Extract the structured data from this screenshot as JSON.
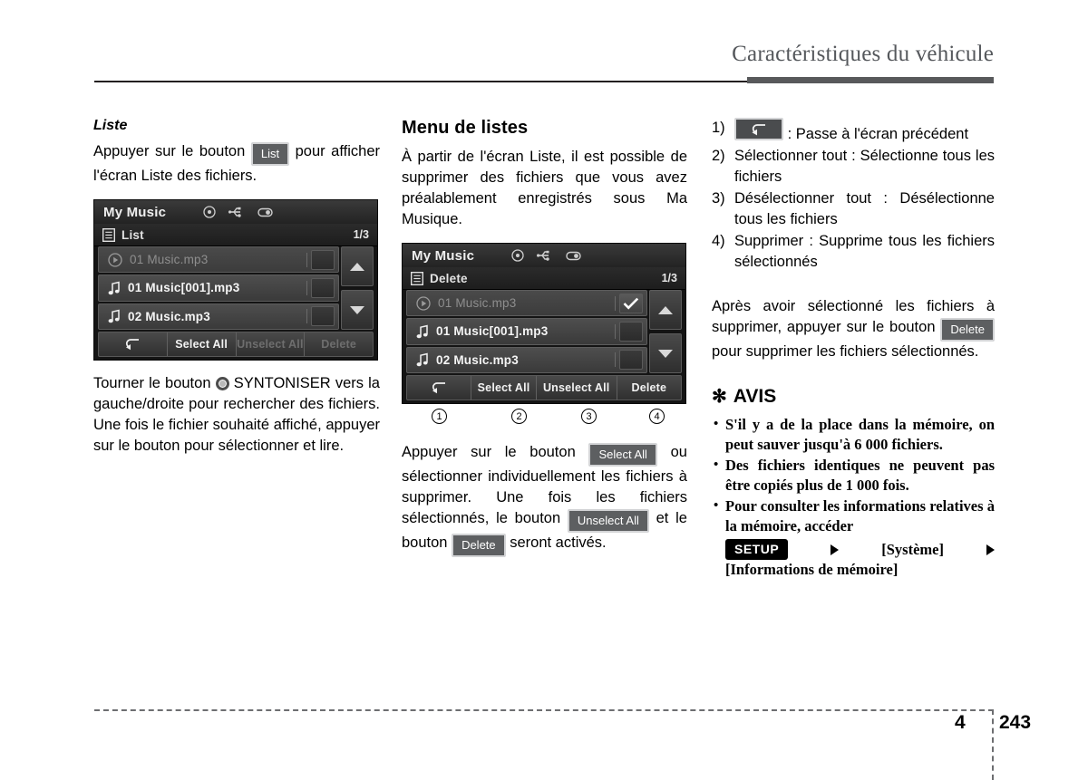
{
  "header": {
    "title": "Caractéristiques du véhicule"
  },
  "footer": {
    "chapter": "4",
    "page": "243"
  },
  "left_column": {
    "section_title": "Liste",
    "paragraph_1_before": "Appuyer sur le bouton",
    "list_button_label": "List",
    "paragraph_1_after": "pour afficher l'écran Liste des fichiers.",
    "paragraph_2_before": "Tourner le bouton",
    "paragraph_2_after": "SYNTONISER vers la gauche/droite pour rechercher des fichiers. Une fois le fichier souhaité affiché, appuyer sur le bouton pour sélectionner et lire."
  },
  "screenshot_list": {
    "title": "My Music",
    "submenu_label": "List",
    "page_indicator": "1/3",
    "rows": [
      {
        "label": "01 Music.mp3",
        "icon": "play-circle-icon",
        "playing": true,
        "checked": false
      },
      {
        "label": "01 Music[001].mp3",
        "icon": "music-note-icon",
        "playing": false,
        "checked": false
      },
      {
        "label": "02 Music.mp3",
        "icon": "music-note-icon",
        "playing": false,
        "checked": false
      }
    ],
    "buttons": [
      {
        "label": "",
        "icon": "back-arrow-icon",
        "enabled": true
      },
      {
        "label": "Select All",
        "enabled": true
      },
      {
        "label": "Unselect All",
        "enabled": false
      },
      {
        "label": "Delete",
        "enabled": false
      }
    ],
    "scroll_up_icon": "triangle-up-icon",
    "scroll_down_icon": "triangle-down-icon",
    "status_icons": [
      "disc-icon",
      "usb-icon",
      "ipod-icon"
    ]
  },
  "mid_column": {
    "section_title": "Menu de listes",
    "paragraph_1": "À partir de l'écran Liste, il est possible de supprimer des fichiers que vous avez préalablement enregistrés sous Ma Musique.",
    "paragraph_2_a": "Appuyer sur le bouton",
    "select_all_label": "Select All",
    "paragraph_2_b": "ou sélectionner individuellement les fichiers à supprimer. Une fois les fichiers sélectionnés, le bouton",
    "unselect_all_label": "Unselect All",
    "paragraph_2_c": "et le bouton",
    "delete_label": "Delete",
    "paragraph_2_d": "seront activés."
  },
  "screenshot_delete": {
    "title": "My Music",
    "submenu_label": "Delete",
    "page_indicator": "1/3",
    "rows": [
      {
        "label": "01 Music.mp3",
        "icon": "play-circle-icon",
        "playing": true,
        "checked": true
      },
      {
        "label": "01 Music[001].mp3",
        "icon": "music-note-icon",
        "playing": false,
        "checked": false
      },
      {
        "label": "02 Music.mp3",
        "icon": "music-note-icon",
        "playing": false,
        "checked": false
      }
    ],
    "buttons": [
      {
        "label": "",
        "icon": "back-arrow-icon",
        "enabled": true
      },
      {
        "label": "Select All",
        "enabled": true
      },
      {
        "label": "Unselect All",
        "enabled": true
      },
      {
        "label": "Delete",
        "enabled": true
      }
    ],
    "callouts": [
      "1",
      "2",
      "3",
      "4"
    ],
    "scroll_up_icon": "triangle-up-icon",
    "scroll_down_icon": "triangle-down-icon",
    "status_icons": [
      "disc-icon",
      "usb-icon",
      "ipod-icon"
    ]
  },
  "right_column": {
    "items": [
      {
        "num": "1)",
        "icon": "back-arrow-icon",
        "text": ": Passe à l'écran précédent"
      },
      {
        "num": "2)",
        "text": "Sélectionner tout : Sélectionne tous les fichiers"
      },
      {
        "num": "3)",
        "text": "Désélectionner tout : Désélectionne tous les fichiers"
      },
      {
        "num": "4)",
        "text": "Supprimer : Supprime tous les fichiers sélectionnés"
      }
    ],
    "paragraph_a": "Après avoir sélectionné les fichiers à supprimer, appuyer sur le bouton",
    "delete_label": "Delete",
    "paragraph_b": "pour supprimer les fichiers sélectionnés.",
    "notice": {
      "star": "✻",
      "title": "AVIS",
      "bullets": [
        "S'il y a de la place dans la mémoire, on peut sauver jusqu'à 6 000 fichiers.",
        "Des fichiers identiques ne peuvent pas être copiés plus de 1 000 fois."
      ],
      "bullet_3_text": "Pour consulter les informations relatives à la mémoire, accéder",
      "setup_label": "SETUP",
      "system_label": "[Système]",
      "memory_info_label": "[Informations de mémoire]"
    }
  },
  "colors": {
    "header_text": "#55585c",
    "header_rule": "#58595b",
    "badge_bg": "#5d5f61",
    "setup_badge_bg": "#000000",
    "screen_bg": "#141414"
  }
}
